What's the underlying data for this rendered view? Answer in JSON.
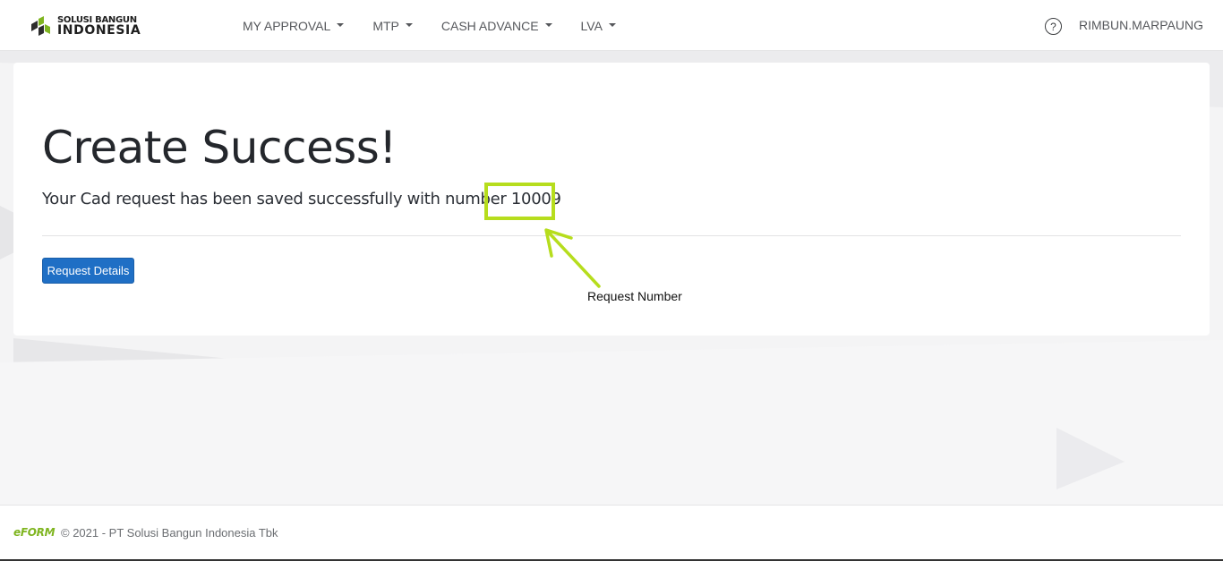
{
  "header": {
    "logo_top": "SOLUSI BANGUN",
    "logo_bottom": "INDONESIA",
    "nav": [
      {
        "label": "MY APPROVAL"
      },
      {
        "label": "MTP"
      },
      {
        "label": "CASH ADVANCE"
      },
      {
        "label": "LVA"
      }
    ],
    "help_icon": "?",
    "user": "RIMBUN.MARPAUNG"
  },
  "main": {
    "title": "Create Success!",
    "message_prefix": "Your Cad request has been saved successfully with number ",
    "request_number": "10009",
    "button_label": "Request Details"
  },
  "annotation": {
    "label": "Request Number",
    "color": "#b6dd1d"
  },
  "footer": {
    "logo": "eFORM",
    "text": "© 2021 - PT Solusi Bangun Indonesia Tbk"
  },
  "colors": {
    "primary_button": "#1f6fc5",
    "brand_green": "#7fb520",
    "logo_dark": "#2d2d2d"
  }
}
